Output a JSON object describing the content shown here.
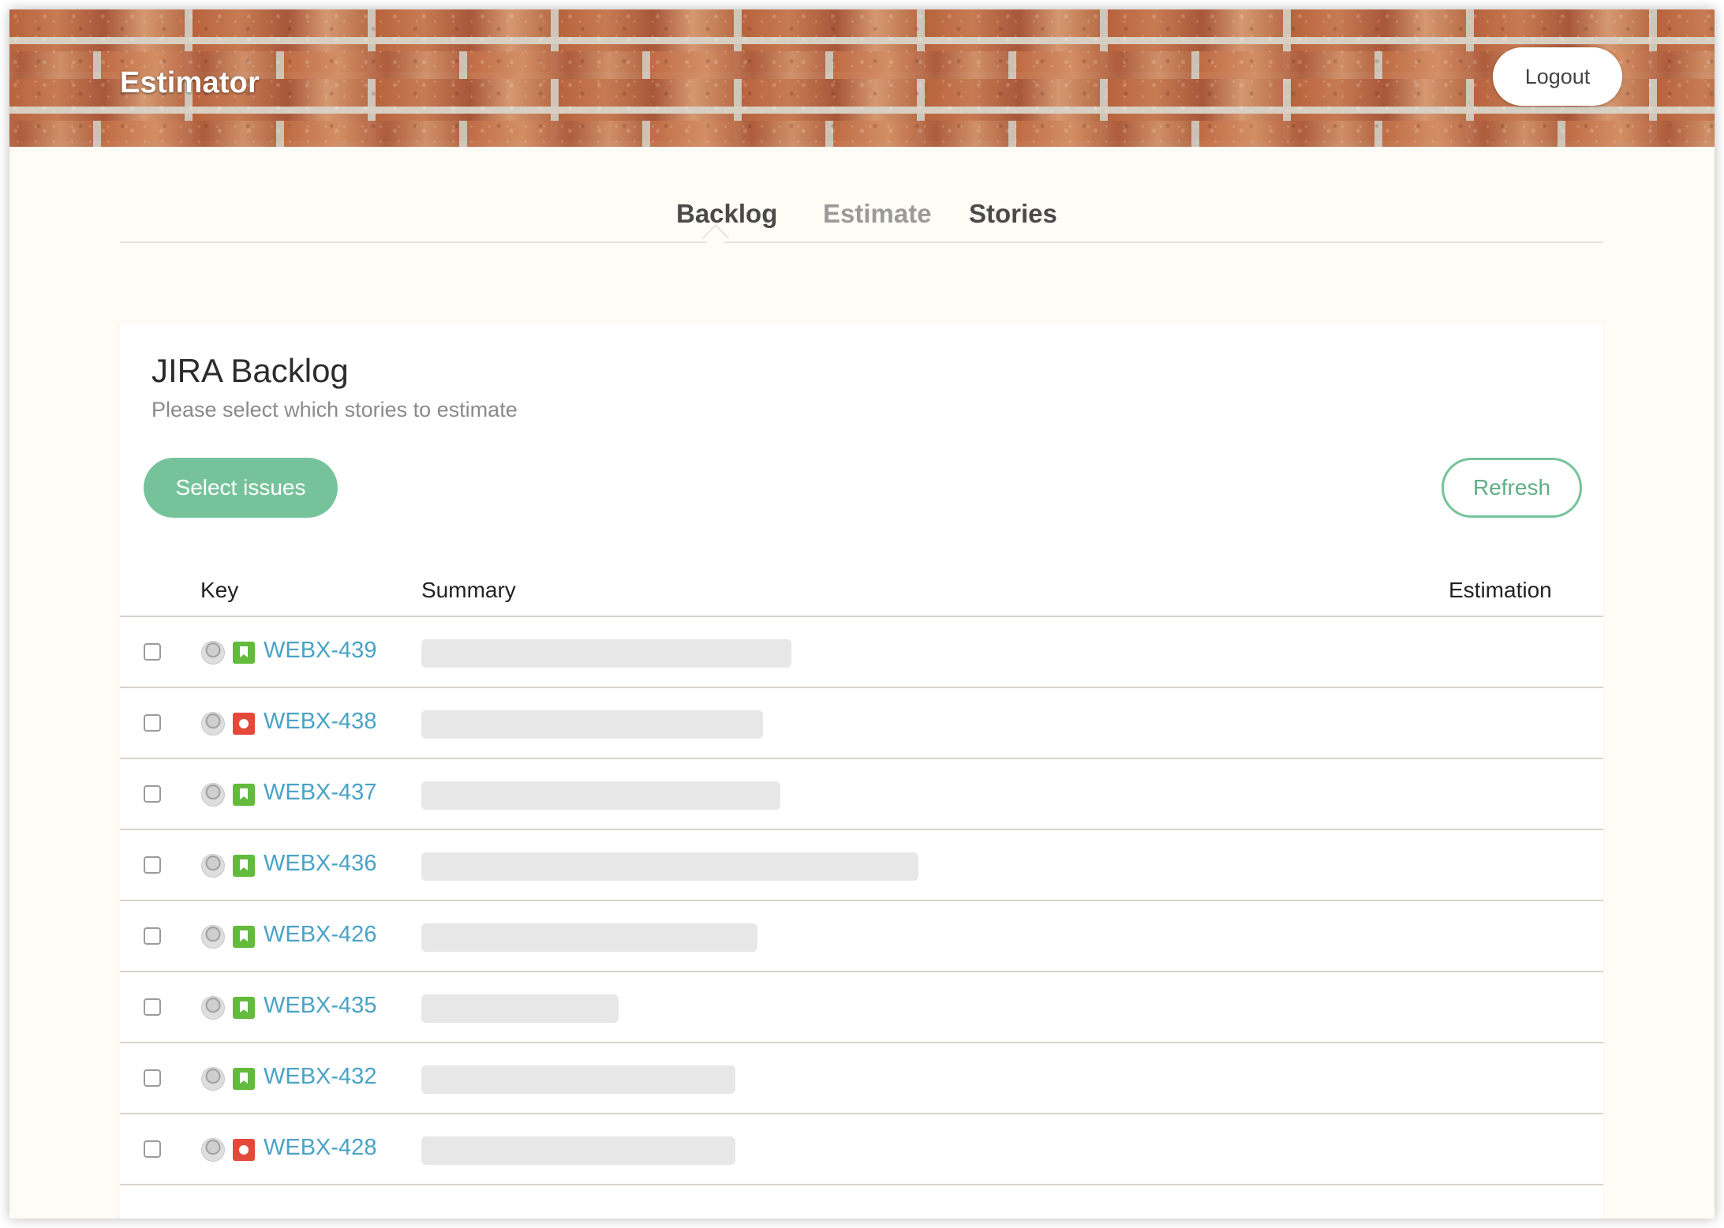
{
  "header": {
    "title": "Estimator",
    "logout_label": "Logout"
  },
  "tabs": [
    {
      "label": "Backlog",
      "active": true
    },
    {
      "label": "Estimate",
      "active": false
    },
    {
      "label": "Stories",
      "active": false
    }
  ],
  "backlog": {
    "title": "JIRA Backlog",
    "subtitle": "Please select which stories to estimate",
    "select_label": "Select issues",
    "refresh_label": "Refresh",
    "columns": {
      "key": "Key",
      "summary": "Summary",
      "estimation": "Estimation"
    },
    "rows": [
      {
        "key": "WEBX-439",
        "type": "story",
        "summary": "",
        "estimation": ""
      },
      {
        "key": "WEBX-438",
        "type": "bug",
        "summary": "",
        "estimation": ""
      },
      {
        "key": "WEBX-437",
        "type": "story",
        "summary": "",
        "estimation": ""
      },
      {
        "key": "WEBX-436",
        "type": "story",
        "summary": "",
        "estimation": ""
      },
      {
        "key": "WEBX-426",
        "type": "story",
        "summary": "",
        "estimation": ""
      },
      {
        "key": "WEBX-435",
        "type": "story",
        "summary": "",
        "estimation": ""
      },
      {
        "key": "WEBX-432",
        "type": "story",
        "summary": "",
        "estimation": ""
      },
      {
        "key": "WEBX-428",
        "type": "bug",
        "summary": "",
        "estimation": ""
      }
    ]
  },
  "colors": {
    "accent": "#76c39b",
    "link": "#4aa3c6",
    "story_icon": "#63ba3c",
    "bug_icon": "#e5493a",
    "background": "#fffcf5"
  },
  "icons": {
    "story": "bookmark-icon",
    "bug": "bug-icon",
    "assignee": "avatar"
  }
}
